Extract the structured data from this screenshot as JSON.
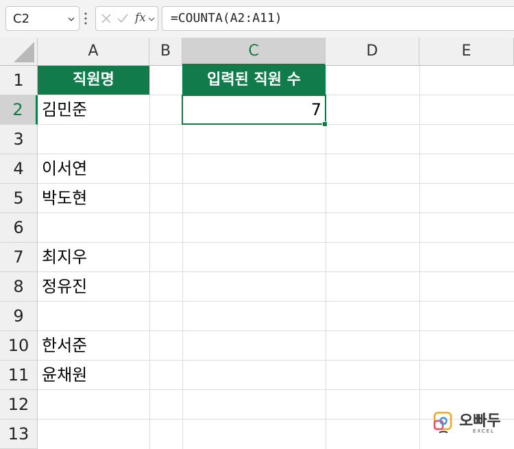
{
  "formula_bar": {
    "name_box": "C2",
    "fx_label": "fx",
    "formula": "=COUNTA(A2:A11)"
  },
  "columns": [
    "A",
    "B",
    "C",
    "D",
    "E"
  ],
  "rows": [
    "1",
    "2",
    "3",
    "4",
    "5",
    "6",
    "7",
    "8",
    "9",
    "10",
    "11",
    "12",
    "13"
  ],
  "cells": {
    "A1": "직원명",
    "C1": "입력된 직원 수",
    "C2": "7",
    "A2": "김민준",
    "A4": "이서연",
    "A5": "박도현",
    "A7": "최지우",
    "A8": "정유진",
    "A10": "한서준",
    "A11": "윤채원"
  },
  "selected_cell": "C2",
  "logo": {
    "title": "오빠두",
    "subtitle": "EXCEL"
  },
  "colors": {
    "accent": "#107c41",
    "header_fill": "#117b4b"
  },
  "icons": [
    "chevron-down-icon",
    "more-vertical-icon",
    "cancel-icon",
    "confirm-icon",
    "chevron-down-icon"
  ]
}
